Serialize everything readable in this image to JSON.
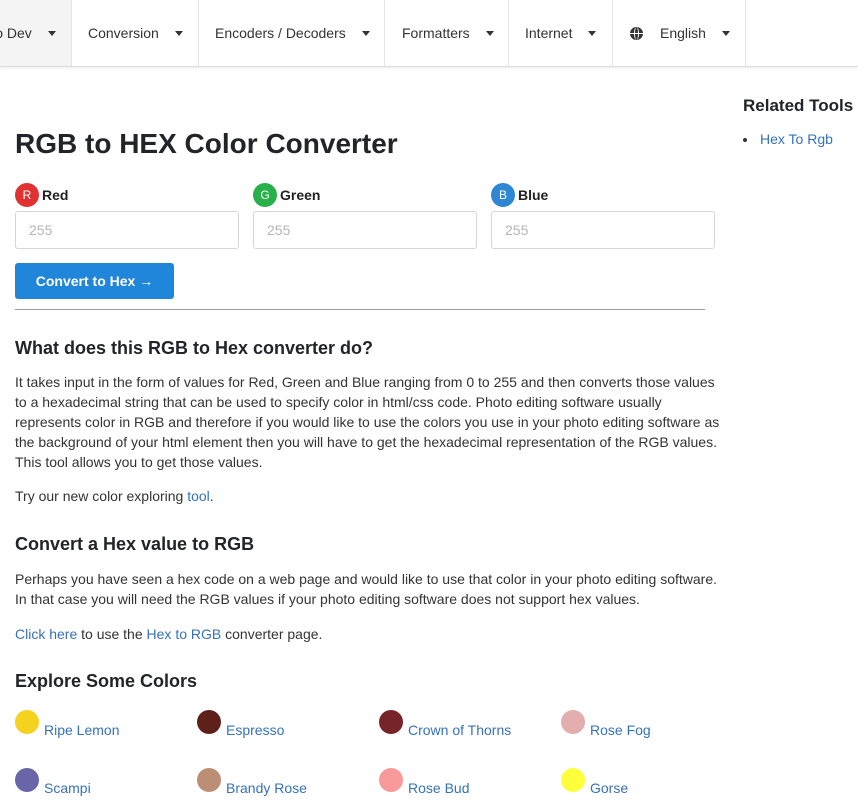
{
  "nav": {
    "items": [
      {
        "label": "o Dev"
      },
      {
        "label": "Conversion"
      },
      {
        "label": "Encoders / Decoders"
      },
      {
        "label": "Formatters"
      },
      {
        "label": "Internet"
      },
      {
        "label": "English",
        "icon": "globe-icon"
      }
    ]
  },
  "main": {
    "title": "RGB to HEX Color Converter",
    "fields": [
      {
        "badge": "R",
        "label": "Red",
        "placeholder": "255",
        "color": "#e03232"
      },
      {
        "badge": "G",
        "label": "Green",
        "placeholder": "255",
        "color": "#28b04a"
      },
      {
        "badge": "B",
        "label": "Blue",
        "placeholder": "255",
        "color": "#2d87d3"
      }
    ],
    "convert_button": "Convert to Hex →",
    "sections": {
      "what_heading": "What does this RGB to Hex converter do?",
      "what_body": "It takes input in the form of values for Red, Green and Blue ranging from 0 to 255 and then converts those values to a hexadecimal string that can be used to specify color in html/css code. Photo editing software usually represents color in RGB and therefore if you would like to use the colors you use in your photo editing software as the background of your html element then you will have to get the hexadecimal representation of the RGB values. This tool allows you to get those values.",
      "try_prefix": "Try our new color exploring ",
      "try_link": "tool",
      "try_suffix": ".",
      "convert_heading": "Convert a Hex value to RGB",
      "convert_body": "Perhaps you have seen a hex code on a web page and would like to use that color in your photo editing software. In that case you will need the RGB values if your photo editing software does not support hex values.",
      "click_here_link": "Click here",
      "click_middle": " to use the ",
      "hex_to_rgb_link": "Hex to RGB",
      "click_suffix": " converter page.",
      "explore_heading": "Explore Some Colors"
    },
    "colors": [
      {
        "name": "Ripe Lemon",
        "hex": "#f5d21e"
      },
      {
        "name": "Espresso",
        "hex": "#5e2119"
      },
      {
        "name": "Crown of Thorns",
        "hex": "#76232a"
      },
      {
        "name": "Rose Fog",
        "hex": "#e3aeae"
      },
      {
        "name": "Scampi",
        "hex": "#6965a8"
      },
      {
        "name": "Brandy Rose",
        "hex": "#bd8e76"
      },
      {
        "name": "Rose Bud",
        "hex": "#f79a99"
      },
      {
        "name": "Gorse",
        "hex": "#ffff3c"
      }
    ]
  },
  "sidebar": {
    "title": "Related Tools",
    "items": [
      {
        "label": "Hex To Rgb"
      }
    ]
  },
  "colors": {
    "accent": "#1f86d9",
    "link": "#3672b9"
  }
}
